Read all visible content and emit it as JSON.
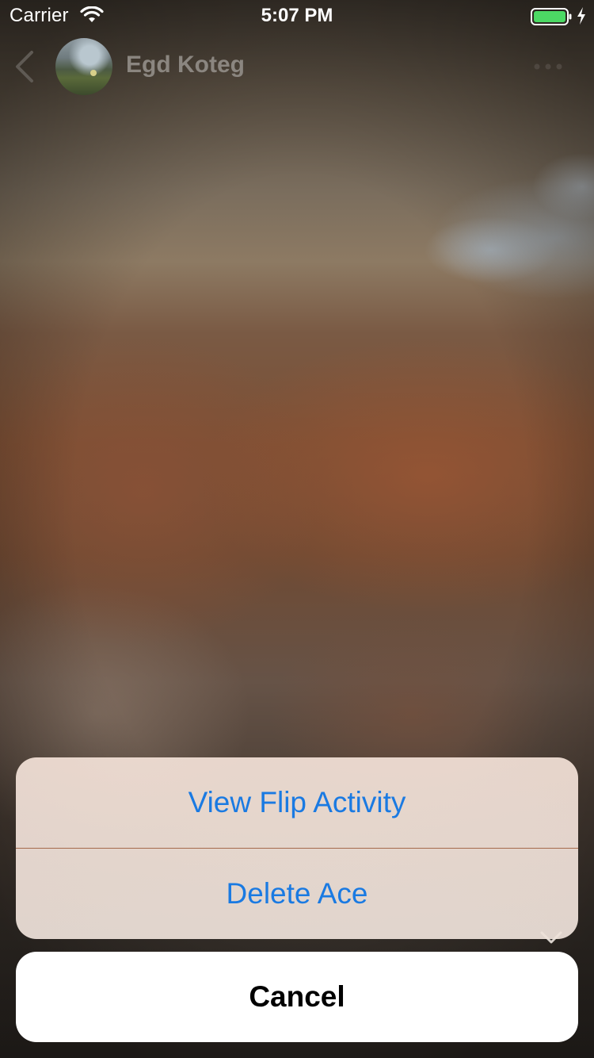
{
  "status_bar": {
    "carrier": "Carrier",
    "time": "5:07 PM",
    "battery_color": "#4cd964"
  },
  "header": {
    "contact_name": "Egd Koteg",
    "back_icon": "chevron-left-icon",
    "more_icon": "ellipsis-icon"
  },
  "action_sheet": {
    "actions": [
      {
        "label": "View Flip Activity"
      },
      {
        "label": "Delete Ace"
      }
    ],
    "cancel_label": "Cancel",
    "action_color": "#1a7ae2"
  }
}
